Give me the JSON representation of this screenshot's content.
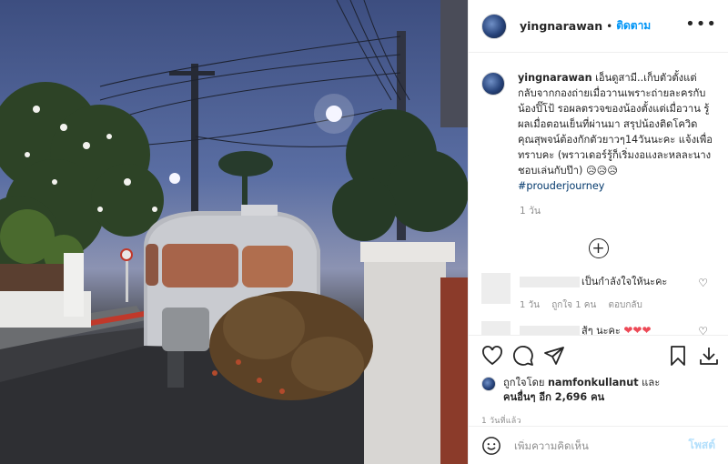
{
  "photo": {
    "alt_icon": "photo-airstream-trailer"
  },
  "header": {
    "username": "yingnarawan",
    "separator": "•",
    "follow_label": "ติดตาม",
    "more_icon": "more-horizontal-icon"
  },
  "caption": {
    "username": "yingnarawan",
    "text": "เอ็นดูสามี..เก็บตัวตั้งแต่กลับจากกองถ่ายเมื่อวานเพราะถ่ายละครกับน้องปิ๊โป้ รอผลตรวจของน้องตั้งแต่เมื่อวาน รู้ผลเมื่อตอนเย็นที่ผ่านมา สรุปน้องติดโควิด คุณสุพจน์ต้องกักตัวยาวๆ14วันนะคะ แจ้งเพื่อทราบคะ (พราวเดอร์รู้ก็เริ่มงอแงละหลละนางชอบเล่นกับป๊า)",
    "emojis": "😥😥😥",
    "hashtag": "#prouderjourney",
    "age": "1 วัน"
  },
  "load_more_icon": "plus-circle-icon",
  "comments": [
    {
      "text": "เป็นกำลังใจให้นะคะ",
      "age": "1 วัน",
      "likes": "ถูกใจ 1 คน",
      "reply": "ตอบกลับ"
    },
    {
      "text": "สู้ๆ นะคะ",
      "hearts": "❤❤❤"
    }
  ],
  "actions": {
    "like_icon": "heart-icon",
    "comment_icon": "comment-icon",
    "share_icon": "share-icon",
    "save_icon": "bookmark-icon",
    "download_icon": "download-icon"
  },
  "likes": {
    "prefix": "ถูกใจโดย",
    "user": "namfonkullanut",
    "and": "และ",
    "others": "คนอื่นๆ อีก 2,696 คน"
  },
  "timestamp": "1 วันที่แล้ว",
  "add_comment": {
    "placeholder": "เพิ่มความคิดเห็น",
    "post_label": "โพสต์"
  }
}
